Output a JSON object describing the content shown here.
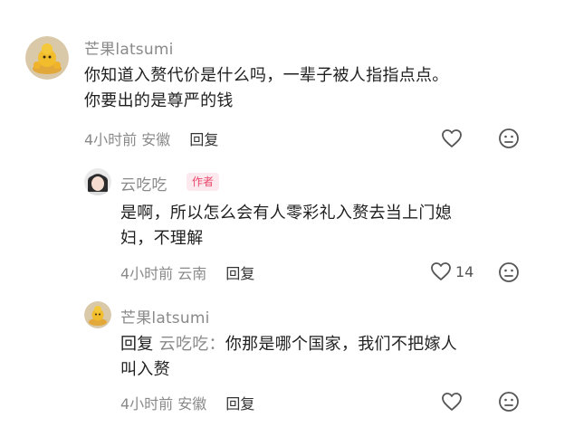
{
  "comments": [
    {
      "username": "芒果latsumi",
      "text_line1": "你知道入赘代价是什么吗，一辈子被人指指点点。",
      "text_line2": "你要出的是尊严的钱",
      "time": "4小时前",
      "location": "安徽",
      "reply_label": "回复",
      "like_icon": "heart-outline",
      "dislike_icon": "frown-face"
    },
    {
      "username": "云吃吃",
      "badge": "作者",
      "text_line1": "是啊，所以怎么会有人零彩礼入赘去当上门媳",
      "text_line2": "妇，不理解",
      "time": "4小时前",
      "location": "云南",
      "reply_label": "回复",
      "like_count": "14",
      "like_icon": "heart-outline",
      "dislike_icon": "frown-face"
    },
    {
      "username": "芒果latsumi",
      "reply_prefix": "回复",
      "reply_target": "云吃吃：",
      "text_line1_rest": "你那是哪个国家，我们不把嫁人",
      "text_line2": "叫入赘",
      "time": "4小时前",
      "location": "安徽",
      "reply_label": "回复",
      "like_icon": "heart-outline",
      "dislike_icon": "frown-face"
    }
  ],
  "colors": {
    "meta_gray": "#8a8a8a",
    "badge_pink": "#e8476b",
    "badge_bg": "#fde9ee"
  }
}
